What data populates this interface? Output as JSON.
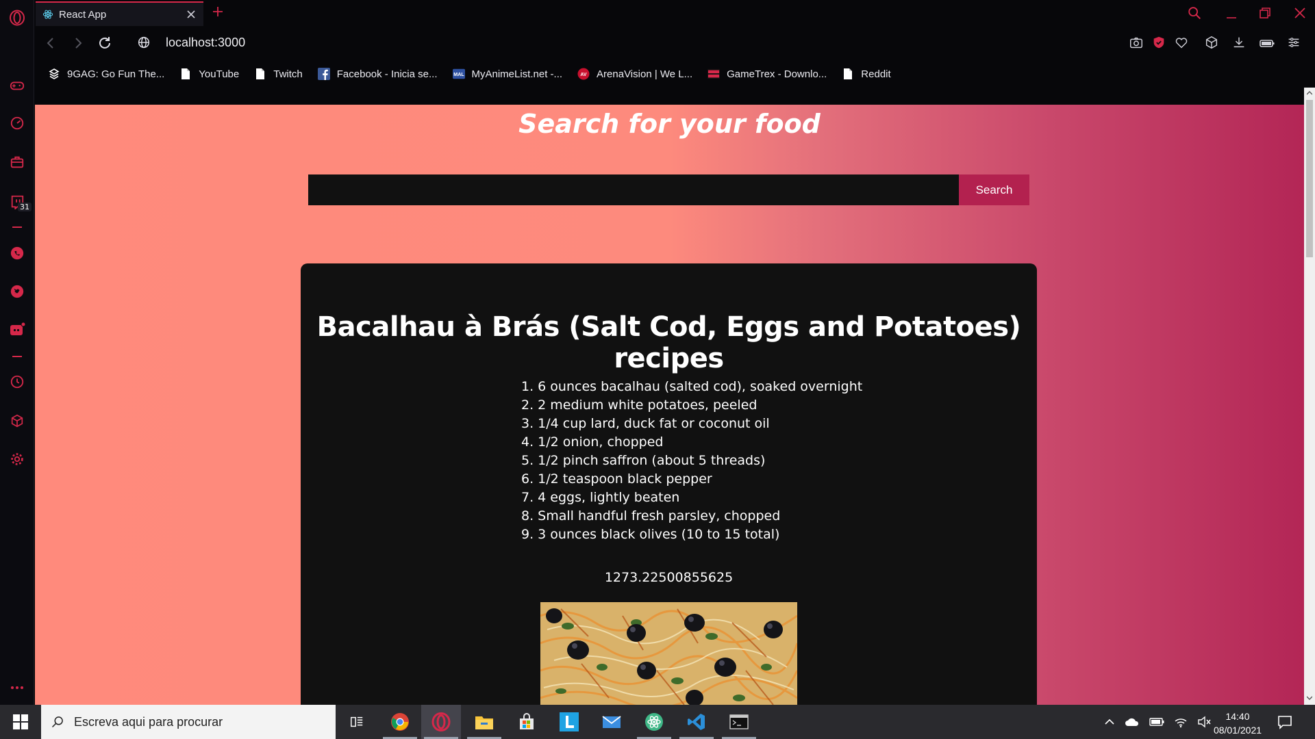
{
  "browser": {
    "tab_title": "React App",
    "url": "localhost:3000",
    "sidebar_badge": "31",
    "accent": "#d6284a"
  },
  "bookmarks": [
    {
      "label": "9GAG: Go Fun The...",
      "icon": "9gag-icon"
    },
    {
      "label": "YouTube",
      "icon": "page-icon"
    },
    {
      "label": "Twitch",
      "icon": "page-icon"
    },
    {
      "label": "Facebook - Inicia se...",
      "icon": "facebook-icon"
    },
    {
      "label": "MyAnimeList.net -...",
      "icon": "mal-icon"
    },
    {
      "label": "ArenaVision | We L...",
      "icon": "arenavision-icon"
    },
    {
      "label": "GameTrex - Downlo...",
      "icon": "gametrex-icon"
    },
    {
      "label": "Reddit",
      "icon": "page-icon"
    }
  ],
  "page": {
    "heading": "Search for your food",
    "search_value": "",
    "search_button": "Search",
    "recipe_title": "Bacalhau à Brás (Salt Cod, Eggs and Potatoes) recipes",
    "ingredients": [
      "1. 6 ounces bacalhau (salted cod), soaked overnight",
      "2. 2 medium white potatoes, peeled",
      "3. 1/4 cup lard, duck fat or coconut oil",
      "4. 1/2 onion, chopped",
      "5. 1/2 pinch saffron (about 5 threads)",
      "6. 1/2 teaspoon black pepper",
      "7. 4 eggs, lightly beaten",
      "8. Small handful fresh parsley, chopped",
      "9. 3 ounces black olives (10 to 15 total)"
    ],
    "calories": "1273.22500855625",
    "gradient_start": "#ff8a7c",
    "gradient_end": "#b32656",
    "button_color": "#b3214f"
  },
  "taskbar": {
    "search_placeholder": "Escreva aqui para procurar",
    "time": "14:40",
    "date": "08/01/2021"
  }
}
